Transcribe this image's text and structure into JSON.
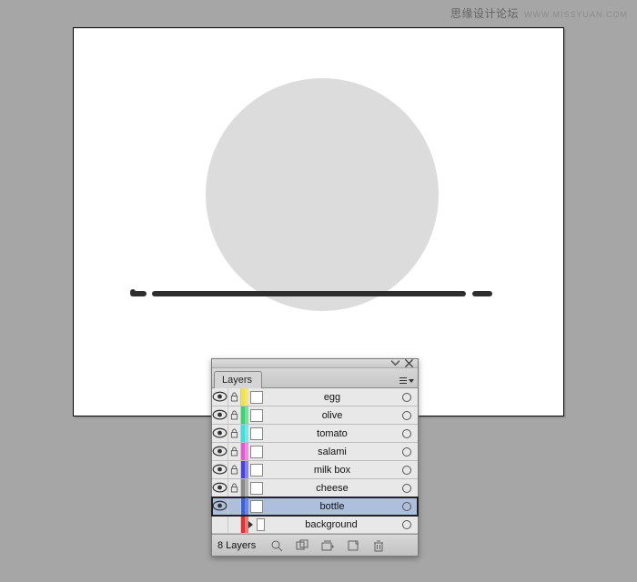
{
  "watermark": {
    "main": "思缘设计论坛",
    "sub": "WWW.MISSYUAN.COM"
  },
  "panel": {
    "title": "Layers",
    "footer_count": "8 Layers",
    "layers": [
      {
        "name": "egg",
        "color": "#f6e23a",
        "visible": true,
        "locked": true,
        "selected": false,
        "expand": false
      },
      {
        "name": "olive",
        "color": "#36d66f",
        "visible": true,
        "locked": true,
        "selected": false,
        "expand": false
      },
      {
        "name": "tomato",
        "color": "#36e2e0",
        "visible": true,
        "locked": true,
        "selected": false,
        "expand": false
      },
      {
        "name": "salami",
        "color": "#e858d6",
        "visible": true,
        "locked": true,
        "selected": false,
        "expand": false
      },
      {
        "name": "milk box",
        "color": "#4a3fe0",
        "visible": true,
        "locked": true,
        "selected": false,
        "expand": false
      },
      {
        "name": "cheese",
        "color": "#8a8a8a",
        "visible": true,
        "locked": true,
        "selected": false,
        "expand": false
      },
      {
        "name": "bottle",
        "color": "#3a62e0",
        "visible": true,
        "locked": false,
        "selected": true,
        "expand": false
      },
      {
        "name": "background",
        "color": "#e23030",
        "visible": false,
        "locked": false,
        "selected": false,
        "expand": true
      }
    ]
  }
}
